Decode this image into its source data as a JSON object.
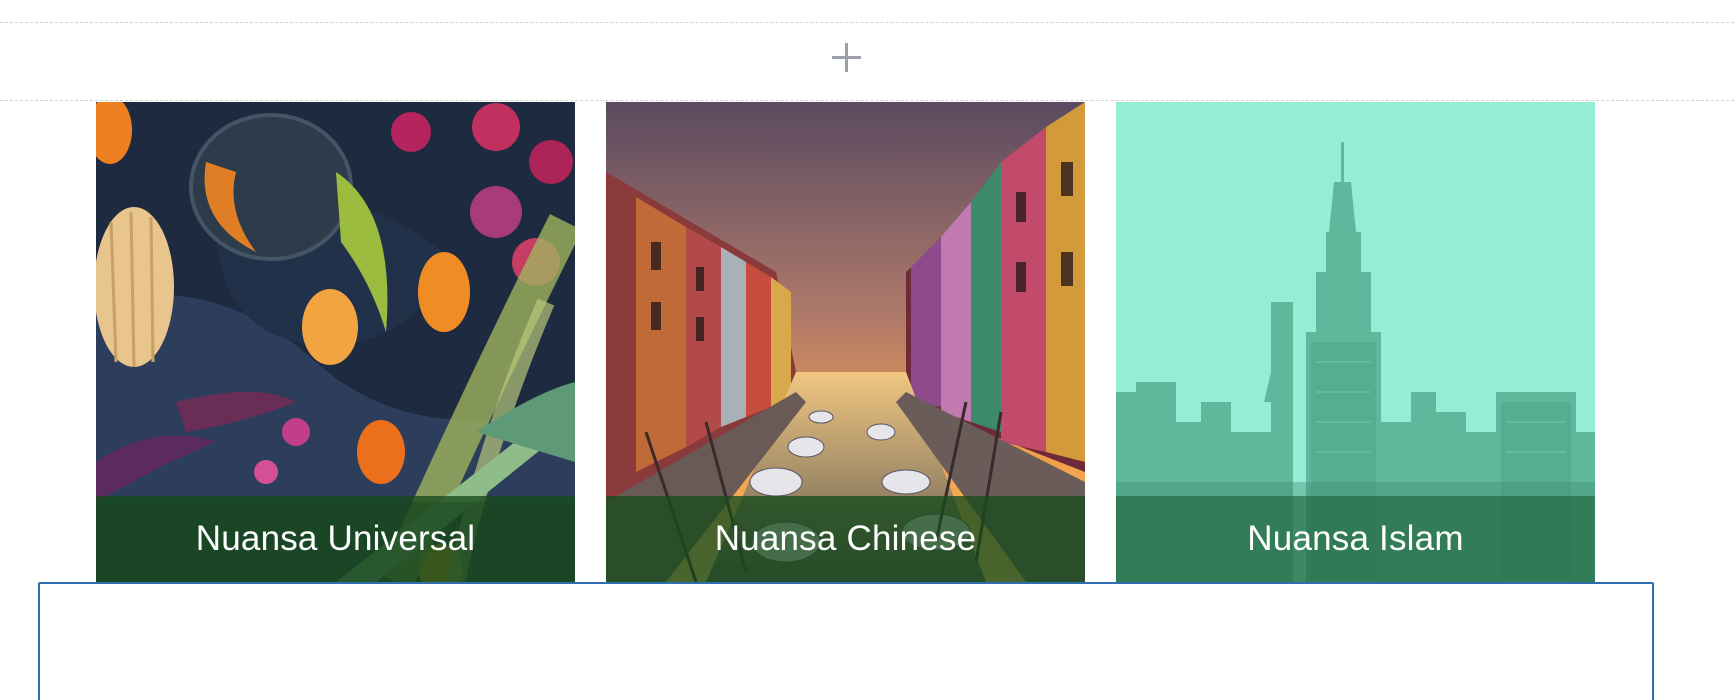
{
  "toolbar": {
    "add_icon": "plus-icon"
  },
  "cards": [
    {
      "title": "Nuansa Universal",
      "image": "vegetables-flatlay-photo"
    },
    {
      "title": "Nuansa Chinese",
      "image": "canal-houses-sunset-photo"
    },
    {
      "title": "Nuansa Islam",
      "image": "city-skyline-teal-photo"
    }
  ],
  "colors": {
    "caption_overlay": "#174a1c",
    "selection_border": "#2f6fad",
    "dashed_border": "#cfd3d8",
    "plus_icon": "#9aa0a6"
  }
}
